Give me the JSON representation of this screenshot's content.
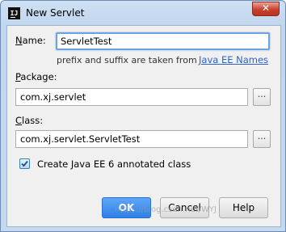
{
  "window": {
    "title": "New Servlet",
    "app_icon_text": "IJ",
    "close_symbol": "✕"
  },
  "form": {
    "name_label": "Name:",
    "name_mnemonic": "N",
    "name_rest": "ame:",
    "name_value": "ServletTest",
    "hint_text": "prefix and suffix are taken from",
    "hint_link": "Java EE Names",
    "package_label_mnemonic": "P",
    "package_label_rest": "ackage:",
    "package_value": "com.xj.servlet",
    "class_label_mnemonic": "C",
    "class_label_rest": "lass:",
    "class_value": "com.xj.servlet.ServletTest",
    "browse_label": "...",
    "checkbox_checked": true,
    "checkbox_label": "Create Java EE 6 annotated class"
  },
  "buttons": {
    "ok": "OK",
    "cancel": "Cancel",
    "help": "Help"
  },
  "watermark": "https://blog.csdn.net/WYJ",
  "colors": {
    "accent": "#2f7fe6",
    "link": "#2d62c8",
    "focus_border": "#6aa2e4"
  }
}
